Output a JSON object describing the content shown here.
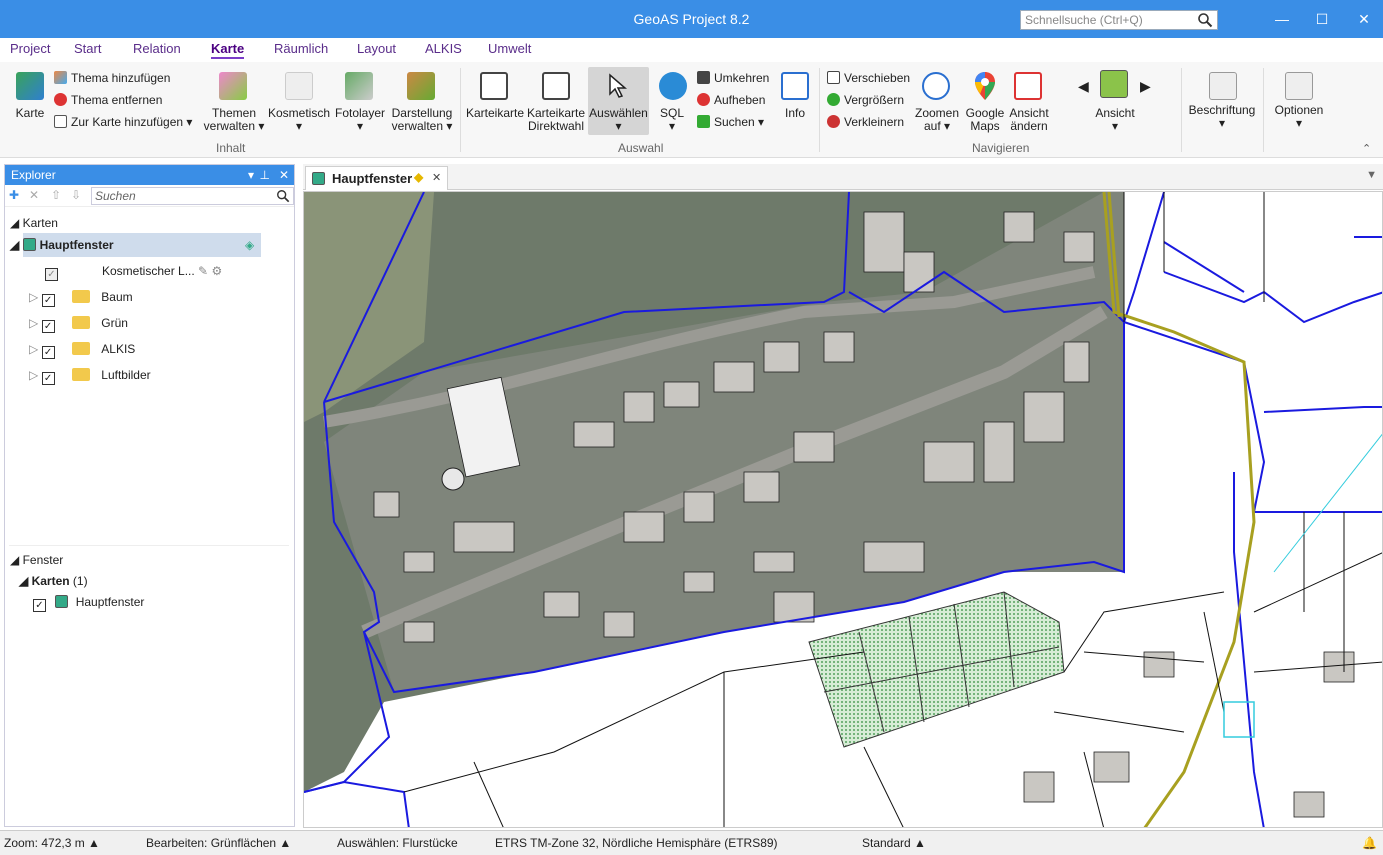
{
  "app": {
    "title": "GeoAS Project 8.2",
    "search_placeholder": "Schnellsuche (Ctrl+Q)"
  },
  "window_controls": {
    "minimize": "—",
    "maximize": "☐",
    "close": "✕"
  },
  "menu": [
    "Project",
    "Start",
    "Relation",
    "Karte",
    "Räumlich",
    "Layout",
    "ALKIS",
    "Umwelt"
  ],
  "ribbon": {
    "inhalt": {
      "karte": "Karte",
      "thema_hinzufuegen": "Thema hinzufügen",
      "thema_entfernen": "Thema entfernen",
      "zur_karte": "Zur Karte hinzufügen",
      "themen_verwalten_1": "Themen",
      "themen_verwalten_2": "verwalten",
      "kosmetisch": "Kosmetisch",
      "fotolayer": "Fotolayer",
      "darstellung_1": "Darstellung",
      "darstellung_2": "verwalten",
      "group": "Inhalt"
    },
    "auswahl": {
      "karteikarte": "Karteikarte",
      "karteikarte_direkt_1": "Karteikarte",
      "karteikarte_direkt_2": "Direktwahl",
      "auswaehlen": "Auswählen",
      "sql": "SQL",
      "umkehren": "Umkehren",
      "aufheben": "Aufheben",
      "suchen": "Suchen",
      "info": "Info",
      "group": "Auswahl"
    },
    "navigieren": {
      "verschieben": "Verschieben",
      "vergroessern": "Vergrößern",
      "verkleinern": "Verkleinern",
      "zoomen_1": "Zoomen",
      "zoomen_2": "auf",
      "google_1": "Google",
      "google_2": "Maps",
      "ansicht_aendern_1": "Ansicht",
      "ansicht_aendern_2": "ändern",
      "ansicht": "Ansicht",
      "group": "Navigieren"
    },
    "beschriftung": "Beschriftung",
    "optionen": "Optionen"
  },
  "explorer": {
    "title": "Explorer",
    "search_placeholder": "Suchen",
    "karten_header": "Karten",
    "hauptfenster": "Hauptfenster",
    "layers": [
      "Kosmetischer L...",
      "Baum",
      "Grün",
      "ALKIS",
      "Luftbilder"
    ],
    "fenster_header": "Fenster",
    "karten_group": "Karten",
    "karten_count": "(1)",
    "fenster_item": "Hauptfenster"
  },
  "document_tab": {
    "label": "Hauptfenster"
  },
  "status": {
    "zoom": "Zoom: 472,3 m",
    "bearbeiten": "Bearbeiten: Grünflächen",
    "auswaehlen": "Auswählen: Flurstücke",
    "crs": "ETRS TM-Zone 32, Nördliche Hemisphäre (ETRS89)",
    "style": "Standard"
  },
  "colors": {
    "accent": "#3a8ee6",
    "menu": "#5a2d8a",
    "parcel_line": "#1a1adf",
    "road_line": "#a8a020",
    "green_area": "#2e8b3a"
  }
}
